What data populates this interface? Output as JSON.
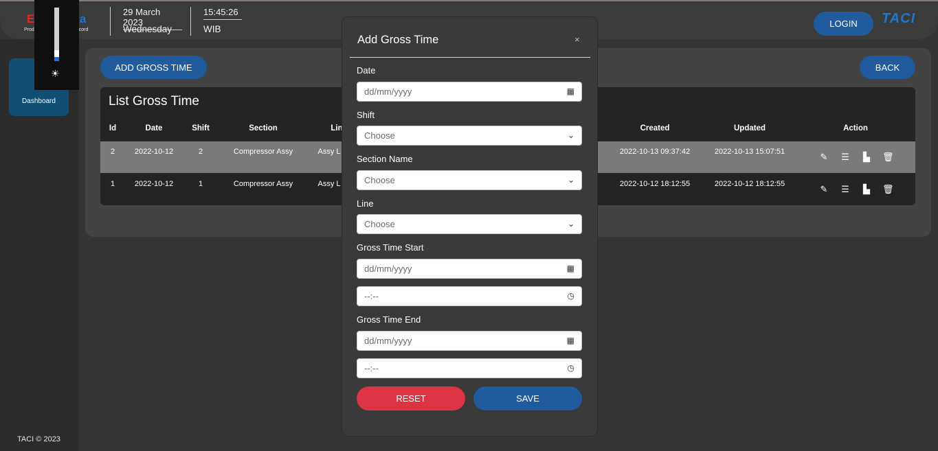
{
  "header": {
    "logo_prefix": "E",
    "logo_suffix": "aka",
    "logo_subtitle": "Production Equipment Record",
    "date": "29 March 2023",
    "day": "Wednesday",
    "time": "15:45:26",
    "timezone": "WIB",
    "login_label": "LOGIN",
    "brand": "TACI"
  },
  "brightness": {
    "level": 0.08,
    "icon": "sun-icon"
  },
  "sidebar": {
    "items": [
      {
        "label": "Dashboard",
        "badge": "1",
        "icon": "home-icon"
      }
    ],
    "footer": "TACI © 2023"
  },
  "main": {
    "add_button": "ADD GROSS TIME",
    "back_button": "BACK",
    "table": {
      "title": "List Gross Time",
      "columns": [
        "Id",
        "Date",
        "Shift",
        "Section",
        "Lin",
        "Created",
        "Updated",
        "Action"
      ],
      "rows": [
        {
          "id": "2",
          "date": "2022-10-12",
          "shift": "2",
          "section": "Compressor Assy",
          "line": "Assy L",
          "created": "2022-10-13 09:37:42",
          "updated": "2022-10-13 15:07:51"
        },
        {
          "id": "1",
          "date": "2022-10-12",
          "shift": "1",
          "section": "Compressor Assy",
          "line": "Assy L",
          "created": "2022-10-12 18:12:55",
          "updated": "2022-10-12 18:12:55"
        }
      ],
      "action_icons": [
        "edit-icon",
        "list-icon",
        "chart-icon",
        "trash-icon"
      ]
    }
  },
  "modal": {
    "title": "Add Gross Time",
    "close": "×",
    "fields": {
      "date_label": "Date",
      "date_placeholder": "dd/mm/yyyy",
      "shift_label": "Shift",
      "shift_value": "Choose",
      "section_label": "Section Name",
      "section_value": "Choose",
      "line_label": "Line",
      "line_value": "Choose",
      "start_label": "Gross Time Start",
      "start_date_placeholder": "dd/mm/yyyy",
      "start_time_placeholder": "--:--",
      "end_label": "Gross Time End",
      "end_date_placeholder": "dd/mm/yyyy",
      "end_time_placeholder": "--:--"
    },
    "reset_label": "RESET",
    "save_label": "SAVE"
  }
}
